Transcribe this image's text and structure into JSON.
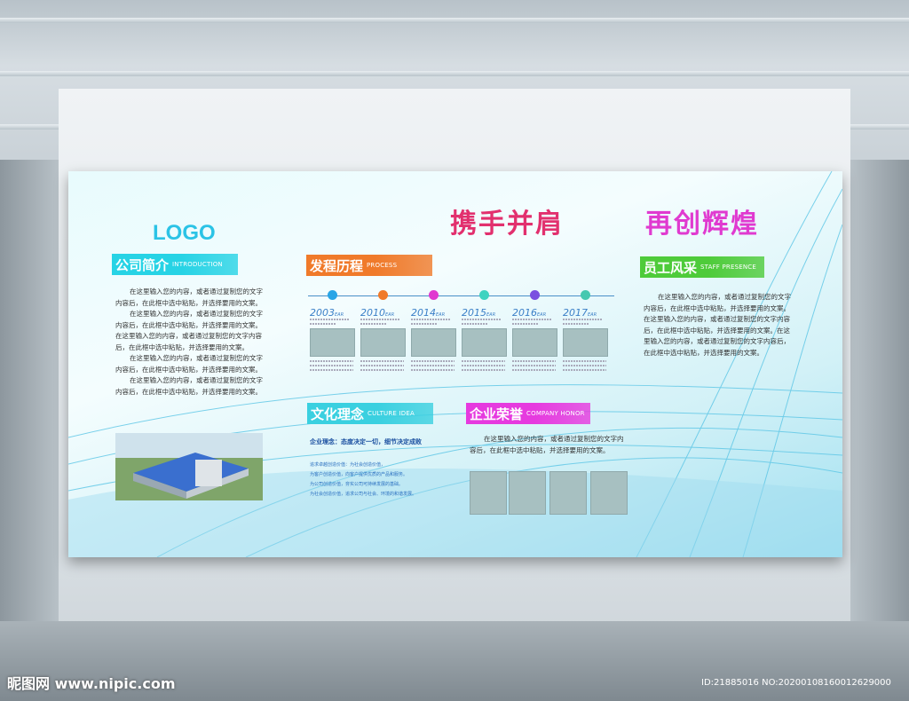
{
  "board": {
    "logo": "LOGO",
    "slogan_left": "携手并肩",
    "slogan_right": "再创辉煌",
    "intro": {
      "title_cn": "公司简介",
      "title_en": "INTRODUCTION",
      "color": "#27d3e5",
      "paragraphs": [
        "在这里输入您的内容，或者通过复制您的文字内容后，在此框中选中粘贴，并选择要用的文案。",
        "在这里输入您的内容，或者通过复制您的文字内容后，在此框中选中粘贴，并选择要用的文案。在这里输入您的内容，或者通过复制您的文字内容后，在此框中选中粘贴，并选择要用的文案。",
        "在这里输入您的内容，或者通过复制您的文字内容后，在此框中选中粘贴，并选择要用的文案。",
        "在这里输入您的内容，或者通过复制您的文字内容后，在此框中选中粘贴，并选择要用的文案。"
      ]
    },
    "process": {
      "title_cn": "发程历程",
      "title_en": "PROCESS",
      "color": "#f07a2a",
      "dot_colors": [
        "#2aa5e6",
        "#f07a2a",
        "#e03ad0",
        "#3fd3c0",
        "#7a4fe0",
        "#45c8b0"
      ],
      "items": [
        {
          "year": "2003",
          "suffix": "EAR"
        },
        {
          "year": "2010",
          "suffix": "EAR"
        },
        {
          "year": "2014",
          "suffix": "EAR"
        },
        {
          "year": "2015",
          "suffix": "EAR"
        },
        {
          "year": "2016",
          "suffix": "EAR"
        },
        {
          "year": "2017",
          "suffix": "EAR"
        }
      ]
    },
    "culture": {
      "title_cn": "文化理念",
      "title_en": "CULTURE IDEA",
      "color": "#3ad0e0",
      "motto": "企业理念：态度决定一切，细节决定成败",
      "lines": [
        "追求卓越创造价值：为社会创造价值，",
        "为客户创造价值，向客户提供优质的产品和服务。",
        "为公司创造价值，夯实公司可持续发展的基础。",
        "为社会创造价值，追求公司与社会、环境的和谐发展。"
      ]
    },
    "honor": {
      "title_cn": "企业荣誉",
      "title_en": "COMPANY HONOR",
      "color": "#e63adf",
      "text": "在这里输入您的内容，或者通过复制您的文字内容后，在此框中选中粘贴，并选择要用的文案。"
    },
    "staff": {
      "title_cn": "员工风采",
      "title_en": "STAFF PRESENCE",
      "color": "#4ecb3a",
      "text": "在这里输入您的内容，或者通过复制您的文字内容后，在此框中选中粘贴，并选择要用的文案。在这里输入您的内容，或者通过复制您的文字内容后，在此框中选中粘贴，并选择要用的文案。在这里输入您的内容，或者通过复制您的文字内容后，在此框中选中粘贴，并选择要用的文案。"
    }
  },
  "watermark": "昵图网 www.nipic.com",
  "image_info": "ID:21885016 NO:20200108160012629000"
}
